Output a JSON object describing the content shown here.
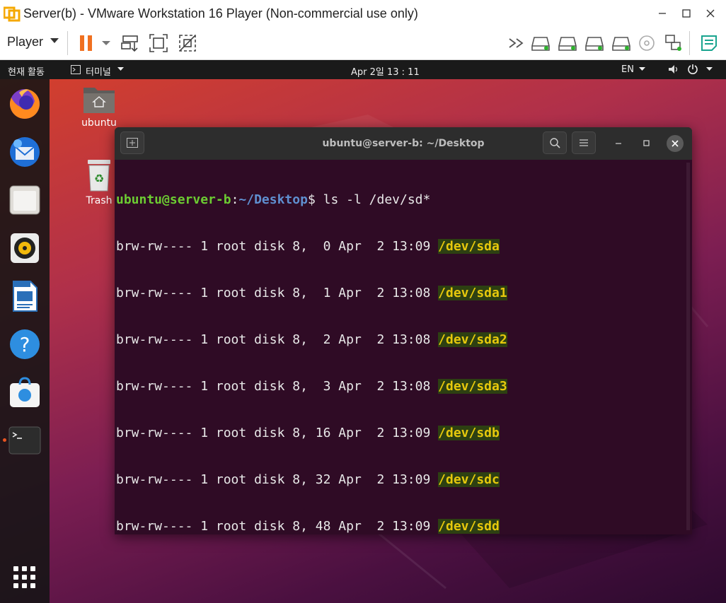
{
  "vm": {
    "title": "Server(b) - VMware Workstation 16 Player (Non-commercial use only)",
    "player_label": "Player"
  },
  "topbar": {
    "activities": "현재 활동",
    "app_menu": "터미널",
    "clock": "Apr 2일  13 : 11",
    "lang": "EN"
  },
  "desktop": {
    "home_label": "ubuntu",
    "trash_label": "Trash"
  },
  "dock": {
    "items": [
      "Firefox",
      "Thunderbird",
      "Files",
      "Rhythmbox",
      "LibreOffice Writer",
      "Help",
      "Ubuntu Software",
      "Terminal"
    ]
  },
  "terminal": {
    "title": "ubuntu@server-b: ~/Desktop",
    "prompt_user": "ubuntu@server-b",
    "prompt_path": "~/Desktop",
    "command": " ls -l /dev/sd*",
    "rows": [
      {
        "info": "brw-rw---- 1 root disk 8,  0 Apr  2 13:09 ",
        "dev": "/dev/sda"
      },
      {
        "info": "brw-rw---- 1 root disk 8,  1 Apr  2 13:08 ",
        "dev": "/dev/sda1"
      },
      {
        "info": "brw-rw---- 1 root disk 8,  2 Apr  2 13:08 ",
        "dev": "/dev/sda2"
      },
      {
        "info": "brw-rw---- 1 root disk 8,  3 Apr  2 13:08 ",
        "dev": "/dev/sda3"
      },
      {
        "info": "brw-rw---- 1 root disk 8, 16 Apr  2 13:09 ",
        "dev": "/dev/sdb"
      },
      {
        "info": "brw-rw---- 1 root disk 8, 32 Apr  2 13:09 ",
        "dev": "/dev/sdc"
      },
      {
        "info": "brw-rw---- 1 root disk 8, 48 Apr  2 13:09 ",
        "dev": "/dev/sdd"
      }
    ]
  },
  "colors": {
    "prompt_user": "#6ccc32",
    "prompt_path": "#5f8fd0",
    "device": "#e6c80c",
    "terminal_bg": "#2f0b25"
  }
}
